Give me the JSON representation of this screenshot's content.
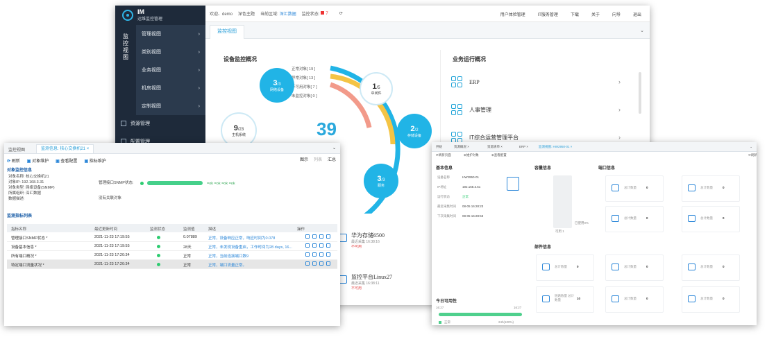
{
  "main": {
    "logo": {
      "title": "IM",
      "subtitle": "运维监控管理"
    },
    "vertical_tab": "监控视图",
    "nav": [
      {
        "label": "管理视图"
      },
      {
        "label": "类别视图"
      },
      {
        "label": "业务视图"
      },
      {
        "label": "机房视图"
      },
      {
        "label": "定制视图"
      }
    ],
    "nav2": [
      {
        "label": "资源管理"
      },
      {
        "label": "配置管理"
      }
    ],
    "topbar": {
      "welcome": "欢迎、demo",
      "theme": "深色主题",
      "region_label": "当前区域:",
      "region_value": "深汇数据",
      "monitor_label": "监控状态:",
      "monitor_count": "7",
      "right_links": [
        "用户体验管理",
        "IT服务管理",
        "下载",
        "关于",
        "向导",
        "退出"
      ]
    },
    "tab": "监控视图",
    "device_section": {
      "title": "设备监控概况",
      "legend": [
        "正常对象[ 19 ]",
        "异常对象[ 13 ]",
        "不可用对象[ 7 ]",
        "未监控对象[ 0 ]"
      ],
      "total": "39",
      "bubbles": [
        {
          "num": "3",
          "den": "/3",
          "label": "网络设备"
        },
        {
          "num": "1",
          "den": "/5",
          "label": "中间件"
        },
        {
          "num": "2",
          "den": "/2",
          "label": "存储设备"
        },
        {
          "num": "3",
          "den": "/3",
          "label": "服务"
        },
        {
          "num": "9",
          "den": "/23",
          "label": "主机系统"
        }
      ]
    },
    "business_section": {
      "title": "业务运行概况",
      "items": [
        "ERP",
        "人事管理",
        "IT综合运营管理平台"
      ]
    },
    "devices_list": [
      {
        "title": "华为存储6500",
        "sub": "最近采集 16:38:16",
        "warn": "不可用"
      },
      {
        "title": "监控平台Linux27",
        "sub": "最近采集 16:38:11",
        "warn": "不可用"
      }
    ]
  },
  "left": {
    "tabs": [
      "监控视图",
      "监测信息: 核心交换机21"
    ],
    "toolbar": [
      "刷新",
      "对象维护",
      "查看配置",
      "指标维护"
    ],
    "toolbar_right": [
      "图示",
      "列表",
      "汇总"
    ],
    "section1": "对象监控信息",
    "info": [
      "对象名称: 核心交换机21",
      "对象IP: 192.168.3.31",
      "对象类型: 网络设备(SNMP)",
      "所属组织: 深汇数据",
      "数据描述:"
    ],
    "snmp_label": "管理接口SNMP状态:",
    "snmp_progress": 1.0,
    "snmp_legend": "=ok =ok =ok =ok",
    "no_related": "没有关联对象",
    "section2": "监测指标列表",
    "columns": [
      "指标名称",
      "最近更新时间",
      "监测状态",
      "监测值",
      "描述",
      "操作"
    ],
    "rows": [
      {
        "name": "管理接口SNMP状态 *",
        "time": "2021-11-23 17:19:55",
        "value": "0.07889",
        "desc": "正常，设备响应正常，响应时间为0.078"
      },
      {
        "name": "设备基本信息 *",
        "time": "2021-11-23 17:19:55",
        "value": "28天",
        "desc": "正常，未发现设备重启，工作时间为28 days, 16..."
      },
      {
        "name": "所有端口概况 *",
        "time": "2021-11-23 17:20:34",
        "value": "正常",
        "desc": "正常，当前连接端口数9"
      },
      {
        "name": "特定端口流量状况 *",
        "time": "2021-11-23 17:20:34",
        "value": "正常",
        "desc": "正常，端口流量正常。"
      }
    ]
  },
  "right": {
    "tabs": [
      "开始",
      "资源概况 ×",
      "资源清单 ×",
      "ERP ×",
      "监测视图: HW2950-01 ×"
    ],
    "toolbar": [
      "刷新页面",
      "维护对象",
      "查看配置"
    ],
    "toolbar_right": "刷新",
    "basic_title": "基本信息",
    "basic_rows": [
      {
        "label": "设备名称",
        "value": "HW2950-01"
      },
      {
        "label": "IP地址",
        "value": "192.168.3.61"
      },
      {
        "label": "运行状态",
        "value": "正常"
      },
      {
        "label": "最近采集时间",
        "value": "08-05 16:28:23"
      },
      {
        "label": "下次采集时间",
        "value": "08-05 16:28:53"
      }
    ],
    "capacity_title": "容量信息",
    "capacity_caption": "可用 1",
    "capacity_side": "已使用0%",
    "port_title": "端口信息",
    "port_cards": [
      {
        "label": "总计数量",
        "value": "0"
      },
      {
        "label": "总计数量",
        "value": "0"
      },
      {
        "label": "总计数量",
        "value": "0"
      },
      {
        "label": "总计数量",
        "value": "0"
      }
    ],
    "parts_title": "部件信息",
    "parts_cards": [
      {
        "label": "总计数量",
        "value": "0"
      },
      {
        "label": "总计数量",
        "value": "0"
      },
      {
        "label": "总计数量",
        "value": "0"
      },
      {
        "label": "链路数量 总计数量",
        "value": "10"
      },
      {
        "label": "总计数量",
        "value": "0"
      },
      {
        "label": "总计数量",
        "value": "0"
      }
    ],
    "availability_title": "今日可用性",
    "availability_start": "16:27",
    "availability_end": "16:27",
    "availability_legend": "正常",
    "availability_value": "24h(100%)"
  },
  "colors": {
    "accent": "#21b4e6",
    "normal": "#21b4e6",
    "abnormal": "#f4c445",
    "unavailable": "#f29a8a",
    "sidebar": "#1e2a3a"
  }
}
